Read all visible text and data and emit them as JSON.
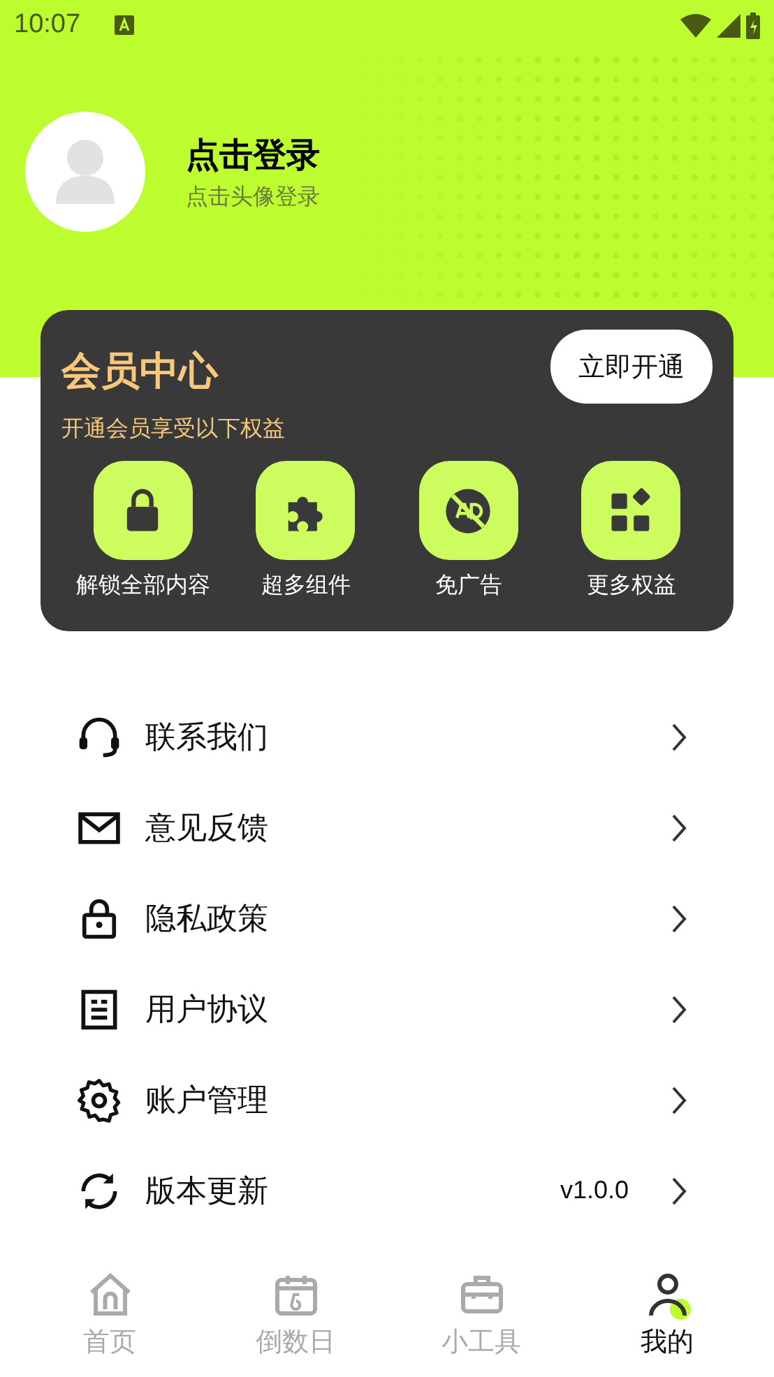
{
  "status_bar": {
    "time": "10:07"
  },
  "profile": {
    "title": "点击登录",
    "subtitle": "点击头像登录"
  },
  "vip_card": {
    "title": "会员中心",
    "button": "立即开通",
    "subtitle": "开通会员享受以下权益",
    "benefits": [
      {
        "kind": "lock",
        "label": "解锁全部内容"
      },
      {
        "kind": "puzzle",
        "label": "超多组件"
      },
      {
        "kind": "noad",
        "label": "免广告"
      },
      {
        "kind": "grid",
        "label": "更多权益"
      }
    ]
  },
  "menu": [
    {
      "kind": "headset",
      "label": "联系我们"
    },
    {
      "kind": "mail",
      "label": "意见反馈"
    },
    {
      "kind": "lock",
      "label": "隐私政策"
    },
    {
      "kind": "doc",
      "label": "用户协议"
    },
    {
      "kind": "gear",
      "label": "账户管理"
    },
    {
      "kind": "sync",
      "label": "版本更新",
      "value": "v1.0.0"
    }
  ],
  "tabs": [
    {
      "kind": "home",
      "label": "首页",
      "selected": false
    },
    {
      "kind": "calendar",
      "label": "倒数日",
      "selected": false
    },
    {
      "kind": "toolbox",
      "label": "小工具",
      "selected": false
    },
    {
      "kind": "person",
      "label": "我的",
      "selected": true
    }
  ]
}
